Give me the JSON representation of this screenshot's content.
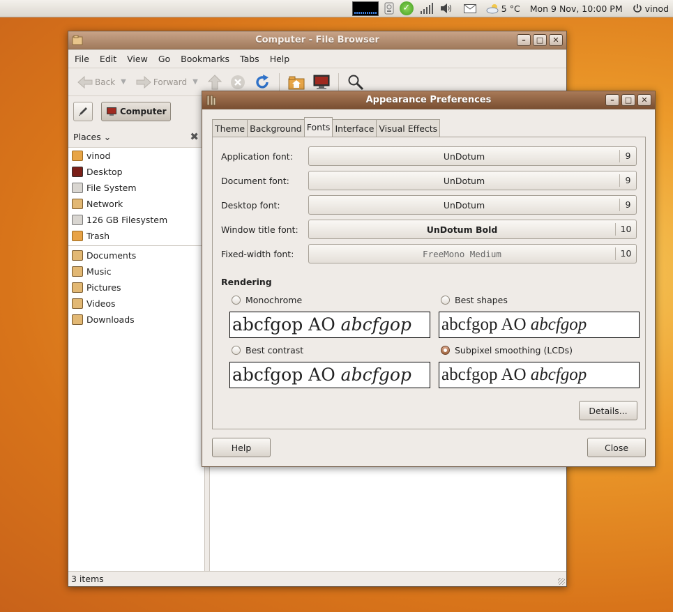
{
  "panel": {
    "weather": "5 °C",
    "clock": "Mon  9 Nov, 10:00 PM",
    "user": "vinod"
  },
  "file_browser": {
    "title": "Computer - File Browser",
    "menu": [
      "File",
      "Edit",
      "View",
      "Go",
      "Bookmarks",
      "Tabs",
      "Help"
    ],
    "toolbar": {
      "back": "Back",
      "forward": "Forward"
    },
    "location": {
      "crumb": "Computer"
    },
    "sidebar": {
      "header": "Places",
      "places": [
        "vinod",
        "Desktop",
        "File System",
        "Network",
        "126 GB Filesystem",
        "Trash"
      ],
      "bookmarks": [
        "Documents",
        "Music",
        "Pictures",
        "Videos",
        "Downloads"
      ]
    },
    "status": "3 items"
  },
  "appearance": {
    "title": "Appearance Preferences",
    "tabs": [
      "Theme",
      "Background",
      "Fonts",
      "Interface",
      "Visual Effects"
    ],
    "active_tab": "Fonts",
    "fonts": [
      {
        "label": "Application font:",
        "name": "UnDotum",
        "size": "9"
      },
      {
        "label": "Document font:",
        "name": "UnDotum",
        "size": "9"
      },
      {
        "label": "Desktop font:",
        "name": "UnDotum",
        "size": "9"
      },
      {
        "label": "Window title font:",
        "name": "UnDotum Bold",
        "size": "10"
      },
      {
        "label": "Fixed-width font:",
        "name": "FreeMono Medium",
        "size": "10"
      }
    ],
    "rendering": {
      "title": "Rendering",
      "options": [
        {
          "label": "Monochrome",
          "checked": false
        },
        {
          "label": "Best shapes",
          "checked": false
        },
        {
          "label": "Best contrast",
          "checked": false
        },
        {
          "label": "Subpixel smoothing (LCDs)",
          "checked": true
        }
      ],
      "sample_regular": "abcfgop AO ",
      "sample_italic": "abcfgop"
    },
    "details_button": "Details...",
    "help_button": "Help",
    "close_button": "Close"
  }
}
